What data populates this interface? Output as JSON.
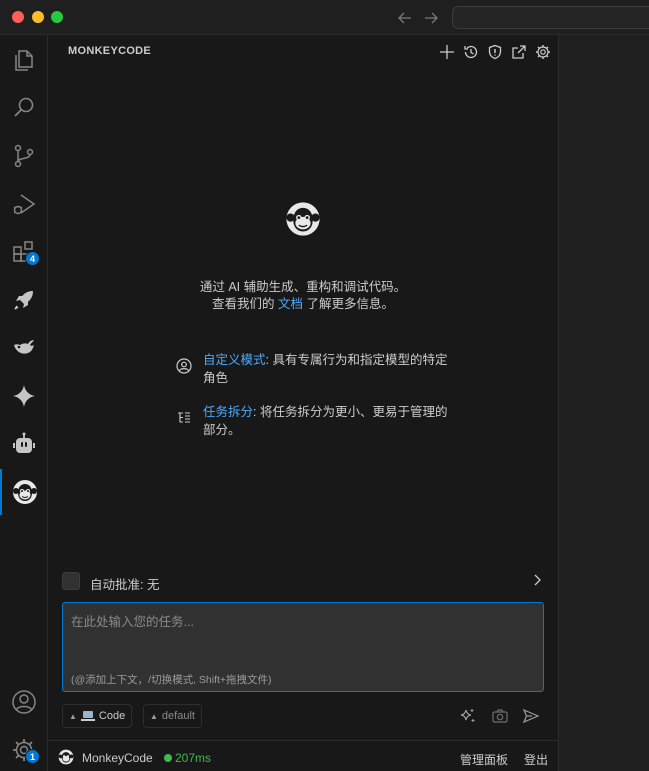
{
  "window": {
    "colors": {
      "close": "#ff5f57",
      "minimize": "#febc2e",
      "maximize": "#28c840"
    }
  },
  "activity_bar": {
    "items": [
      {
        "name": "explorer",
        "icon": "files-icon"
      },
      {
        "name": "search",
        "icon": "search-icon"
      },
      {
        "name": "source-control",
        "icon": "source-control-icon"
      },
      {
        "name": "run-debug",
        "icon": "run-debug-icon"
      },
      {
        "name": "extensions",
        "icon": "extensions-icon",
        "badge": "4"
      },
      {
        "name": "rocket",
        "icon": "rocket-icon"
      },
      {
        "name": "whale",
        "icon": "whale-icon"
      },
      {
        "name": "sparkle",
        "icon": "sparkle-icon"
      },
      {
        "name": "robot",
        "icon": "robot-icon"
      },
      {
        "name": "monkeycode",
        "icon": "monkey-icon",
        "active": true
      }
    ],
    "bottom": [
      {
        "name": "account",
        "icon": "account-icon"
      },
      {
        "name": "manage",
        "icon": "gear-icon",
        "badge": "1"
      }
    ],
    "accent": "#0078d4"
  },
  "panel": {
    "title": "MONKEYCODE",
    "actions": [
      "plus-icon",
      "history-icon",
      "shield-icon",
      "open-external-icon",
      "gear-icon"
    ],
    "intro_line1": "通过 AI 辅助生成、重构和调试代码。",
    "intro_line2_prefix": "查看我们的 ",
    "intro_link": "文档",
    "intro_line2_suffix": " 了解更多信息。",
    "features": [
      {
        "icon": "account-circle-icon",
        "title": "自定义模式",
        "desc": ": 具有专属行为和指定模型的特定角色"
      },
      {
        "icon": "task-list-icon",
        "title": "任务拆分",
        "desc": ": 将任务拆分为更小、更易于管理的部分。"
      }
    ],
    "auto_approve": {
      "label": "自动批准: 无",
      "checked": false
    },
    "input": {
      "placeholder": "在此处输入您的任务...",
      "value": "",
      "hint": "(@添加上下文，/切换模式, Shift+拖拽文件)"
    },
    "toolbar": {
      "mode": "Code",
      "profile": "default",
      "icons": [
        "enhance-prompt-icon",
        "camera-icon",
        "send-icon"
      ]
    },
    "status": {
      "name": "MonkeyCode",
      "latency": "207ms",
      "latency_color": "#3fb950",
      "manage": "管理面板",
      "logout": "登出"
    }
  }
}
